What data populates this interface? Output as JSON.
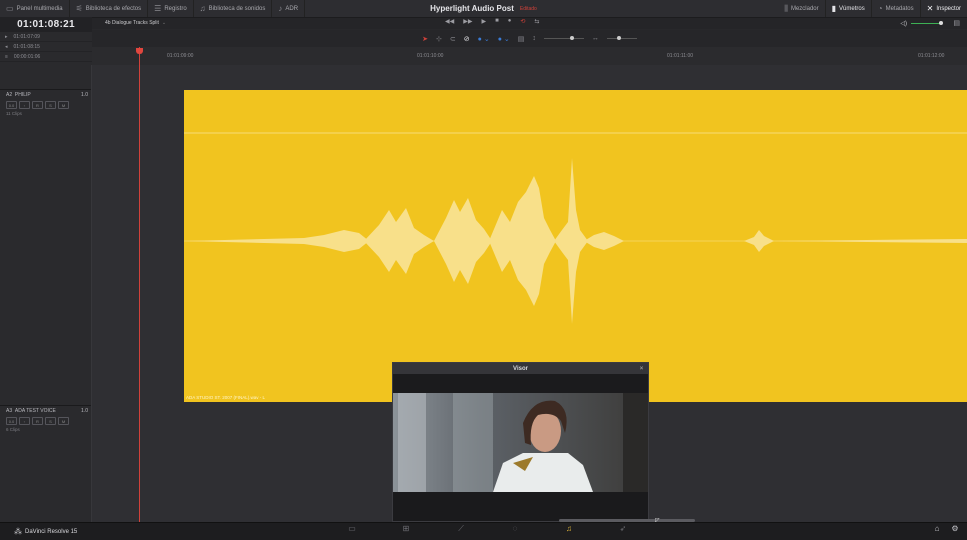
{
  "topbar": {
    "media_pool": "Panel multimedia",
    "effects_library": "Biblioteca de efectos",
    "index": "Registro",
    "sound_library": "Biblioteca de sonidos",
    "adr": "ADR",
    "project_title": "Hyperlight Audio Post",
    "project_status": "Editado",
    "mixer": "Mezclador",
    "meters": "Vúmetros",
    "metadata": "Metadatos",
    "inspector": "Inspector"
  },
  "subbar": {
    "timeline_name": "4b Dialogue Tracks Split"
  },
  "timecode": {
    "main": "01:01:08:21",
    "in": "01:01:07:09",
    "out": "01:01:08:15",
    "duration": "00:00:01:06"
  },
  "ruler": {
    "t1": "01:01:09:00",
    "t2": "01:01:10:00",
    "t3": "01:01:11:00",
    "t4": "01:01:12:00"
  },
  "tracks": [
    {
      "id": "A2",
      "name": "PHILIP",
      "level": "1.0",
      "volume": "0.0",
      "clips": "11 Clips"
    },
    {
      "id": "A3",
      "name": "ADA TEST VOICE",
      "level": "1.0",
      "volume": "0.0",
      "clips": "6 Clips"
    }
  ],
  "track_buttons": {
    "r": "R",
    "s": "S",
    "m": "M"
  },
  "clip": {
    "name": "ADA STUDIO ST. 2007 (FINAL).wav - L"
  },
  "viewer": {
    "title": "Visor"
  },
  "bottombar": {
    "app_name": "DaVinci Resolve 15"
  },
  "colors": {
    "clip": "#f1c41f",
    "playhead": "#d0413a",
    "background": "#2f2f33"
  }
}
